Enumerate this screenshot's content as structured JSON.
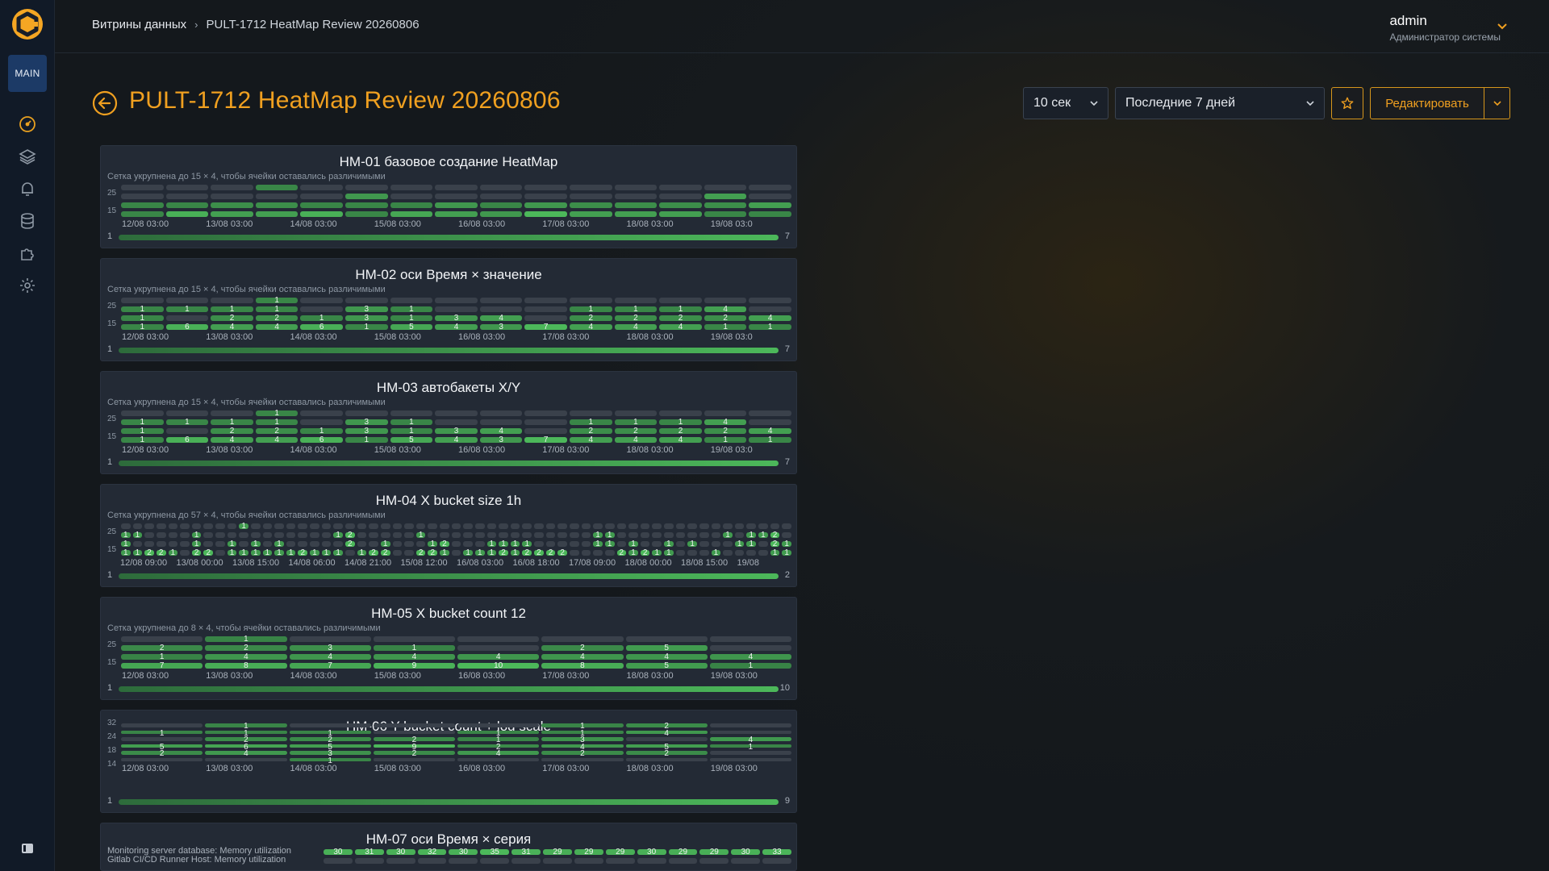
{
  "nav": {
    "main_label": "MAIN",
    "items": [
      {
        "icon": "dashboard-icon"
      },
      {
        "icon": "layers-icon"
      },
      {
        "icon": "bell-icon"
      },
      {
        "icon": "database-icon"
      },
      {
        "icon": "puzzle-icon"
      },
      {
        "icon": "gear-icon"
      }
    ]
  },
  "breadcrumb": {
    "root": "Витрины данных",
    "current": "PULT-1712 HeatMap Review 20260806"
  },
  "user": {
    "name": "admin",
    "role": "Администратор системы"
  },
  "page": {
    "title": "PULT-1712 HeatMap Review 20260806"
  },
  "toolbar": {
    "refresh": "10 сек",
    "time_range": "Последние 7 дней",
    "edit_label": "Редактировать"
  },
  "colors": {
    "accent": "#f0a020",
    "cell_empty": "#3a414b",
    "cell_low": "#2f6a3d",
    "cell_high": "#4cb85a"
  },
  "panels": [
    {
      "title": "HM-01 базовое создание HeatMap",
      "subtitle": "Сетка укрупнена до 15 × 4, чтобы ячейки оставались различимыми",
      "cols": 15,
      "rows": 4,
      "y_ticks": [
        "25",
        "15"
      ],
      "x_ticks": [
        "12/08 03:00",
        "13/08 03:00",
        "14/08 03:00",
        "15/08 03:00",
        "16/08 03:00",
        "17/08 03:00",
        "18/08 03:00",
        "19/08 03:0"
      ],
      "show_values": false,
      "scale": {
        "min": "1",
        "max": "7"
      },
      "cells": [
        [
          0,
          0,
          0,
          1,
          0,
          0,
          0,
          0,
          0,
          0,
          0,
          0,
          0,
          0,
          0
        ],
        [
          0,
          0,
          0,
          0,
          0,
          3,
          0,
          0,
          0,
          0,
          0,
          0,
          0,
          4,
          0
        ],
        [
          1,
          1,
          2,
          2,
          1,
          1,
          1,
          3,
          1,
          3,
          2,
          2,
          2,
          2,
          4
        ],
        [
          1,
          6,
          4,
          4,
          6,
          1,
          5,
          4,
          3,
          7,
          4,
          4,
          4,
          1,
          1
        ]
      ]
    },
    {
      "title": "HM-02 оси Время × значение",
      "subtitle": "Сетка укрупнена до 15 × 4, чтобы ячейки оставались различимыми",
      "cols": 15,
      "rows": 4,
      "y_ticks": [
        "25",
        "15"
      ],
      "x_ticks": [
        "12/08 03:00",
        "13/08 03:00",
        "14/08 03:00",
        "15/08 03:00",
        "16/08 03:00",
        "17/08 03:00",
        "18/08 03:00",
        "19/08 03:0"
      ],
      "show_values": true,
      "scale": {
        "min": "1",
        "max": "7"
      },
      "cells": [
        [
          0,
          0,
          0,
          1,
          0,
          0,
          0,
          0,
          0,
          0,
          0,
          0,
          0,
          0,
          0
        ],
        [
          1,
          1,
          1,
          1,
          0,
          3,
          1,
          0,
          0,
          0,
          1,
          1,
          1,
          4,
          0
        ],
        [
          1,
          0,
          2,
          2,
          1,
          3,
          1,
          3,
          4,
          0,
          2,
          2,
          2,
          2,
          4
        ],
        [
          1,
          6,
          4,
          4,
          6,
          1,
          5,
          4,
          3,
          7,
          4,
          4,
          4,
          1,
          1
        ]
      ]
    },
    {
      "title": "HM-03 автобакеты X/Y",
      "subtitle": "Сетка укрупнена до 15 × 4, чтобы ячейки оставались различимыми",
      "cols": 15,
      "rows": 4,
      "y_ticks": [
        "25",
        "15"
      ],
      "x_ticks": [
        "12/08 03:00",
        "13/08 03:00",
        "14/08 03:00",
        "15/08 03:00",
        "16/08 03:00",
        "17/08 03:00",
        "18/08 03:00",
        "19/08 03:0"
      ],
      "show_values": true,
      "scale": {
        "min": "1",
        "max": "7"
      },
      "cells": [
        [
          0,
          0,
          0,
          1,
          0,
          0,
          0,
          0,
          0,
          0,
          0,
          0,
          0,
          0,
          0
        ],
        [
          1,
          1,
          1,
          1,
          0,
          3,
          1,
          0,
          0,
          0,
          1,
          1,
          1,
          4,
          0
        ],
        [
          1,
          0,
          2,
          2,
          1,
          3,
          1,
          3,
          4,
          0,
          2,
          2,
          2,
          2,
          4
        ],
        [
          1,
          6,
          4,
          4,
          6,
          1,
          5,
          4,
          3,
          7,
          4,
          4,
          4,
          1,
          1
        ]
      ]
    },
    {
      "title": "HM-04 X bucket size 1h",
      "subtitle": "Сетка укрупнена до 57 × 4, чтобы ячейки оставались различимыми",
      "cols": 57,
      "rows": 4,
      "y_ticks": [
        "25",
        "15"
      ],
      "x_ticks": [
        "12/08 09:00",
        "13/08 00:00",
        "13/08 15:00",
        "14/08 06:00",
        "14/08 21:00",
        "15/08 12:00",
        "16/08 03:00",
        "16/08 18:00",
        "17/08 09:00",
        "18/08 00:00",
        "18/08 15:00",
        "19/08"
      ],
      "show_values": true,
      "scale": {
        "min": "1",
        "max": "2"
      },
      "cells": [
        [
          0,
          0,
          0,
          0,
          0,
          0,
          0,
          0,
          0,
          0,
          1,
          0,
          0,
          0,
          0,
          0,
          0,
          0,
          0,
          0,
          0,
          0,
          0,
          0,
          0,
          0,
          0,
          0,
          0,
          0,
          0,
          0,
          0,
          0,
          0,
          0,
          0,
          0,
          0,
          0,
          0,
          0,
          0,
          0,
          0,
          0,
          0,
          0,
          0,
          0,
          0,
          0,
          0,
          0,
          0,
          0,
          0
        ],
        [
          1,
          1,
          0,
          0,
          0,
          0,
          1,
          0,
          0,
          0,
          0,
          0,
          0,
          0,
          0,
          0,
          0,
          0,
          1,
          2,
          0,
          0,
          0,
          0,
          0,
          1,
          0,
          0,
          0,
          0,
          0,
          0,
          0,
          0,
          0,
          0,
          0,
          0,
          0,
          0,
          1,
          1,
          0,
          0,
          0,
          0,
          0,
          0,
          0,
          0,
          0,
          1,
          0,
          1,
          1,
          2,
          0
        ],
        [
          1,
          0,
          0,
          0,
          0,
          0,
          1,
          0,
          0,
          1,
          0,
          1,
          0,
          1,
          0,
          0,
          0,
          0,
          0,
          2,
          0,
          0,
          1,
          0,
          0,
          0,
          1,
          2,
          0,
          0,
          0,
          1,
          1,
          1,
          1,
          0,
          0,
          0,
          0,
          0,
          1,
          1,
          0,
          1,
          0,
          0,
          1,
          0,
          1,
          0,
          0,
          0,
          1,
          1,
          0,
          2,
          1
        ],
        [
          1,
          1,
          2,
          2,
          1,
          0,
          2,
          2,
          0,
          1,
          1,
          1,
          1,
          1,
          1,
          2,
          1,
          1,
          1,
          0,
          1,
          2,
          2,
          0,
          0,
          2,
          2,
          1,
          0,
          1,
          1,
          1,
          2,
          1,
          2,
          2,
          2,
          2,
          0,
          0,
          0,
          0,
          2,
          1,
          2,
          1,
          1,
          0,
          0,
          0,
          1,
          0,
          0,
          0,
          0,
          1,
          1
        ]
      ]
    },
    {
      "title": "HM-05 X bucket count 12",
      "subtitle": "Сетка укрупнена до 8 × 4, чтобы ячейки оставались различимыми",
      "cols": 8,
      "rows": 4,
      "y_ticks": [
        "25",
        "15"
      ],
      "x_ticks": [
        "12/08 03:00",
        "13/08 03:00",
        "14/08 03:00",
        "15/08 03:00",
        "16/08 03:00",
        "17/08 03:00",
        "18/08 03:00",
        "19/08 03:00"
      ],
      "show_values": true,
      "scale": {
        "min": "1",
        "max": "10"
      },
      "cells": [
        [
          0,
          1,
          0,
          0,
          0,
          0,
          0,
          0
        ],
        [
          2,
          2,
          3,
          1,
          0,
          2,
          5,
          0
        ],
        [
          1,
          4,
          4,
          4,
          4,
          4,
          4,
          4
        ],
        [
          7,
          8,
          7,
          9,
          10,
          8,
          5,
          1
        ]
      ]
    },
    {
      "title": "HM-06 Y bucket count + log scale",
      "subtitle": "",
      "cols": 8,
      "rows": 6,
      "y_ticks": [
        "32",
        "24",
        "18",
        "14"
      ],
      "x_ticks": [
        "12/08 03:00",
        "13/08 03:00",
        "14/08 03:00",
        "15/08 03:00",
        "16/08 03:00",
        "17/08 03:00",
        "18/08 03:00",
        "19/08 03:00"
      ],
      "show_values": true,
      "scale": {
        "min": "1",
        "max": "9"
      },
      "cells": [
        [
          0,
          1,
          0,
          0,
          0,
          1,
          2,
          0
        ],
        [
          1,
          1,
          1,
          0,
          1,
          1,
          4,
          0
        ],
        [
          0,
          2,
          2,
          2,
          1,
          3,
          0,
          4
        ],
        [
          5,
          6,
          5,
          9,
          2,
          4,
          5,
          1
        ],
        [
          2,
          4,
          3,
          2,
          4,
          2,
          2,
          0
        ],
        [
          0,
          0,
          1,
          0,
          0,
          0,
          0,
          0
        ]
      ]
    },
    {
      "title": "HM-07 оси Время × серия",
      "subtitle": "",
      "cols": 15,
      "rows": 2,
      "series_labels": [
        "Monitoring server database: Memory utilization",
        "Gitlab CI/CD Runner Host: Memory utilization"
      ],
      "show_values": true,
      "cells": [
        [
          30,
          31,
          30,
          32,
          30,
          35,
          31,
          29,
          29,
          29,
          30,
          29,
          29,
          30,
          33
        ],
        [
          0,
          0,
          0,
          0,
          0,
          0,
          0,
          0,
          0,
          0,
          0,
          0,
          0,
          0,
          0
        ]
      ]
    }
  ]
}
